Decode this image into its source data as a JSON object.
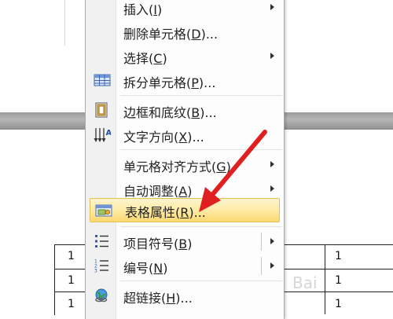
{
  "menu": {
    "items": [
      {
        "name": "insert",
        "text": "插入",
        "key": "I",
        "suffix": ")",
        "submenu": true
      },
      {
        "name": "delete-cells",
        "text": "删除单元格",
        "key": "D",
        "suffix": ")...",
        "submenu": false
      },
      {
        "name": "select",
        "text": "选择",
        "key": "C",
        "suffix": ")",
        "submenu": true
      },
      {
        "name": "split-cells",
        "text": "拆分单元格",
        "key": "P",
        "suffix": ")...",
        "submenu": false,
        "icon": "split-cells-icon"
      },
      {
        "name": "borders-shading",
        "text": "边框和底纹",
        "key": "B",
        "suffix": ")...",
        "submenu": false,
        "icon": "borders-shading-icon"
      },
      {
        "name": "text-direction",
        "text": "文字方向",
        "key": "X",
        "suffix": ")...",
        "submenu": false,
        "icon": "text-direction-icon"
      },
      {
        "name": "cell-alignment",
        "text": "单元格对齐方式",
        "key": "G",
        "suffix": ")",
        "submenu": true
      },
      {
        "name": "autofit",
        "text": "自动调整",
        "key": "A",
        "suffix": ")",
        "submenu": true
      },
      {
        "name": "table-properties",
        "text": "表格属性",
        "key": "R",
        "suffix": ")...",
        "submenu": false,
        "icon": "table-properties-icon",
        "highlighted": true
      },
      {
        "name": "bullets",
        "text": "项目符号",
        "key": "B",
        "suffix": ")",
        "submenu": true,
        "icon": "bullets-icon"
      },
      {
        "name": "numbering",
        "text": "编号",
        "key": "N",
        "suffix": ")",
        "submenu": true,
        "icon": "numbering-icon"
      },
      {
        "name": "hyperlink",
        "text": "超链接",
        "key": "H",
        "suffix": ")...",
        "submenu": false,
        "icon": "hyperlink-icon"
      }
    ]
  },
  "document": {
    "cells": [
      "1",
      "1",
      "1",
      "1",
      "1",
      "1"
    ]
  },
  "watermark": "Bai",
  "colors": {
    "highlight_top": "#fdf4cf",
    "highlight_bottom": "#fbd970",
    "pointer": "#e02020"
  }
}
